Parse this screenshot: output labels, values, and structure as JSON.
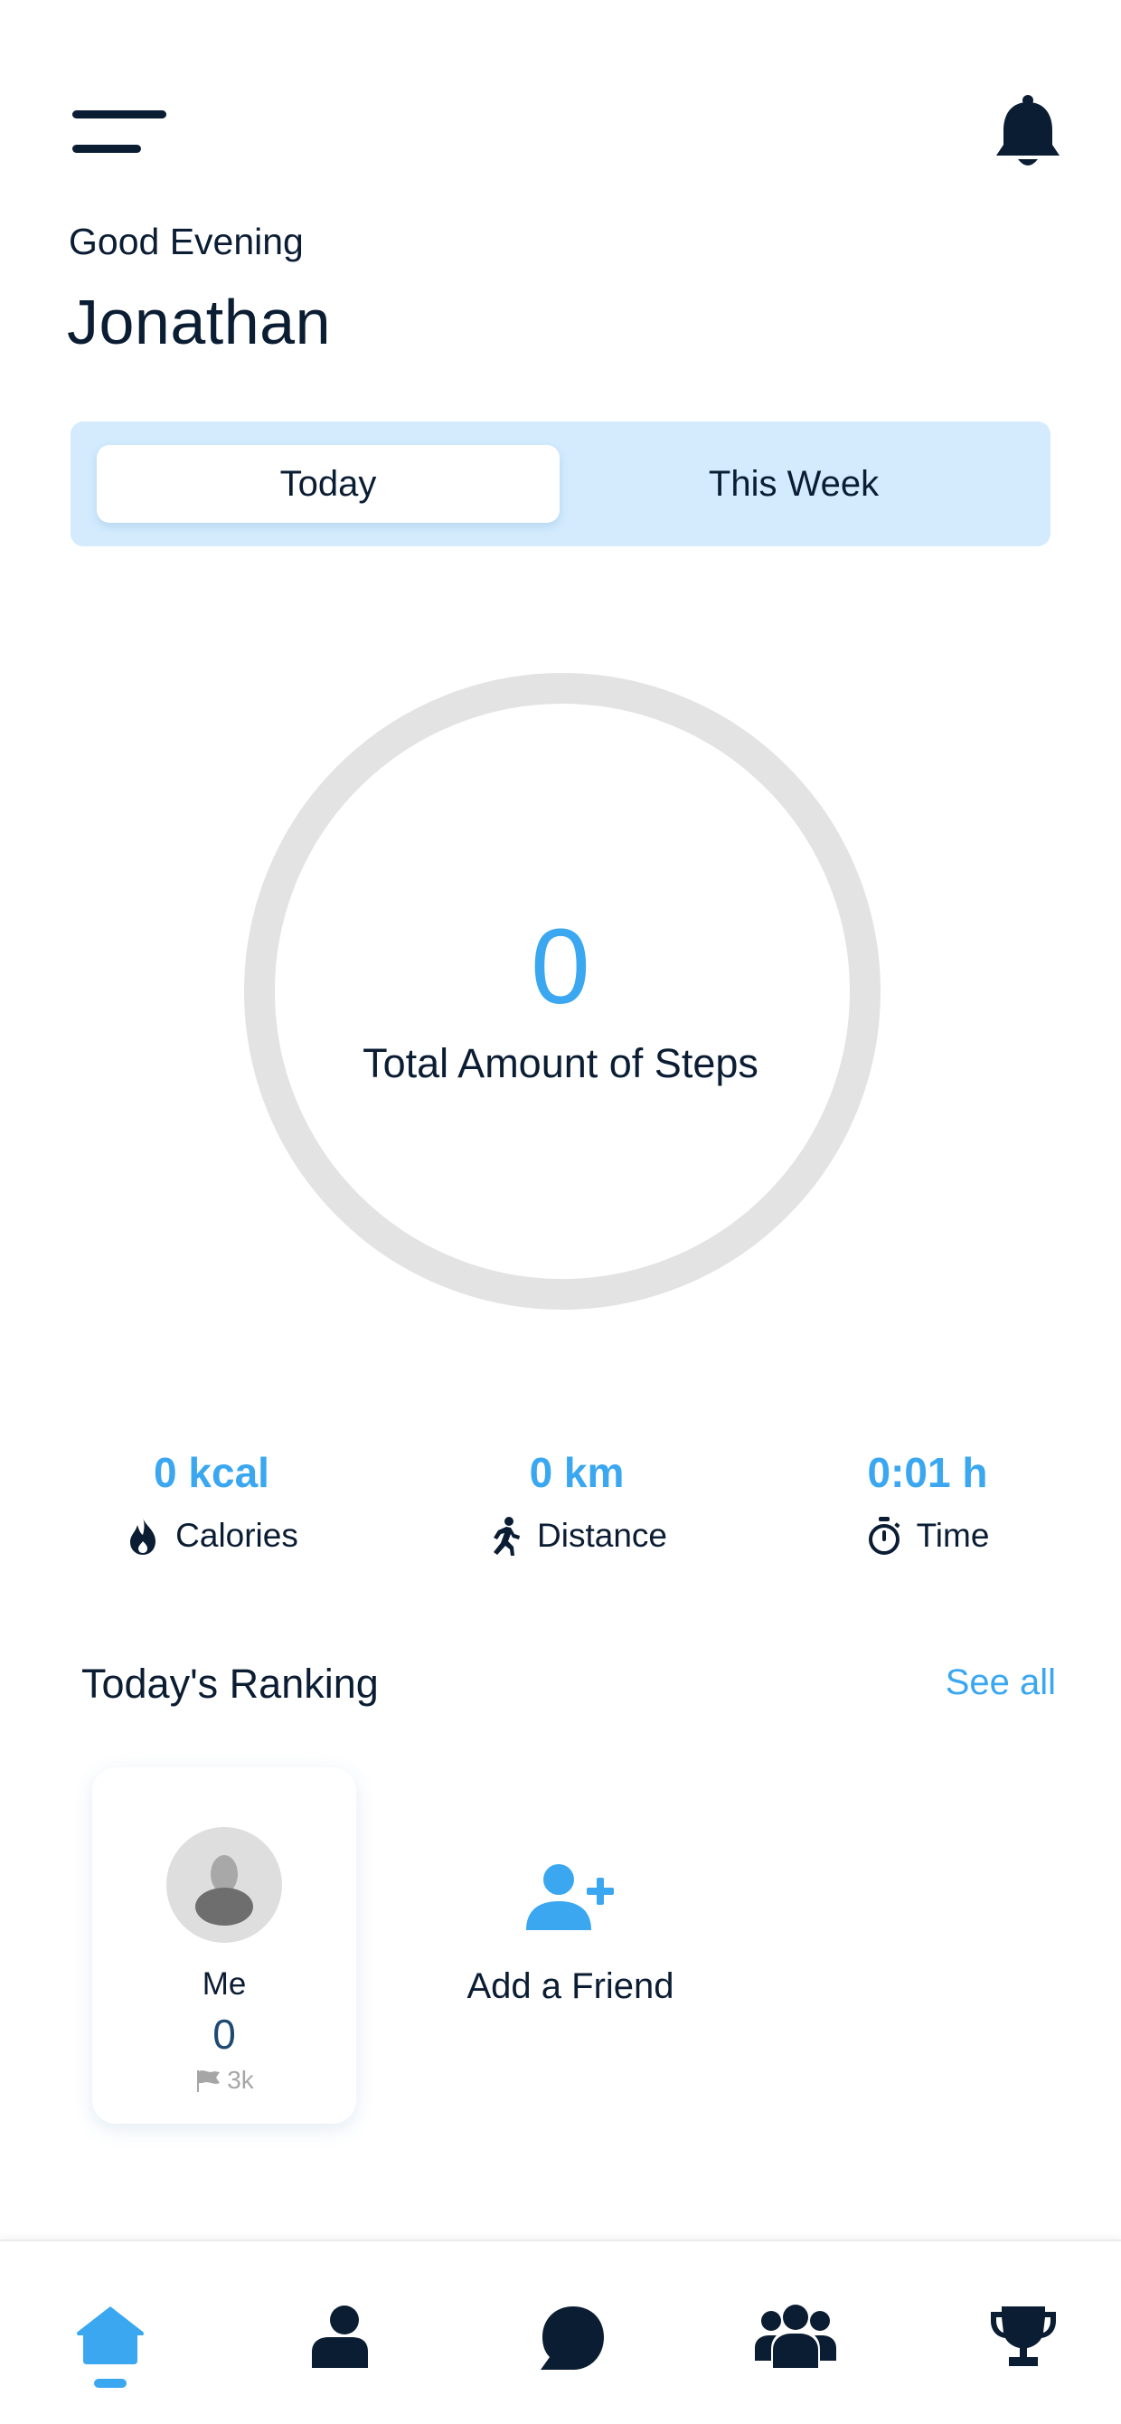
{
  "colors": {
    "accent": "#3aa7f0",
    "dark": "#0b1d33",
    "segment_bg": "#d3ebfd",
    "ring": "#e3e3e3"
  },
  "header": {
    "menu_icon": "hamburger-menu-icon",
    "notification_icon": "bell-icon"
  },
  "greeting": {
    "salutation": "Good Evening",
    "name": "Jonathan"
  },
  "period_tabs": {
    "selected": "Today",
    "today_label": "Today",
    "week_label": "This Week"
  },
  "steps": {
    "value": "0",
    "label": "Total Amount of Steps"
  },
  "stats": {
    "calories": {
      "value": "0 kcal",
      "label": "Calories",
      "icon": "flame-icon"
    },
    "distance": {
      "value": "0 km",
      "label": "Distance",
      "icon": "running-person-icon"
    },
    "time": {
      "value": "0:01 h",
      "label": "Time",
      "icon": "stopwatch-icon"
    }
  },
  "ranking": {
    "title": "Today's Ranking",
    "see_all": "See all",
    "me": {
      "name": "Me",
      "steps": "0",
      "goal": "3k"
    },
    "add_friend": "Add a Friend"
  },
  "bottom_nav": {
    "items": [
      {
        "name": "home",
        "icon": "home-icon",
        "active": true
      },
      {
        "name": "friend",
        "icon": "person-icon",
        "active": false
      },
      {
        "name": "chat",
        "icon": "chat-bubble-icon",
        "active": false
      },
      {
        "name": "groups",
        "icon": "group-icon",
        "active": false
      },
      {
        "name": "trophy",
        "icon": "trophy-icon",
        "active": false
      }
    ]
  }
}
